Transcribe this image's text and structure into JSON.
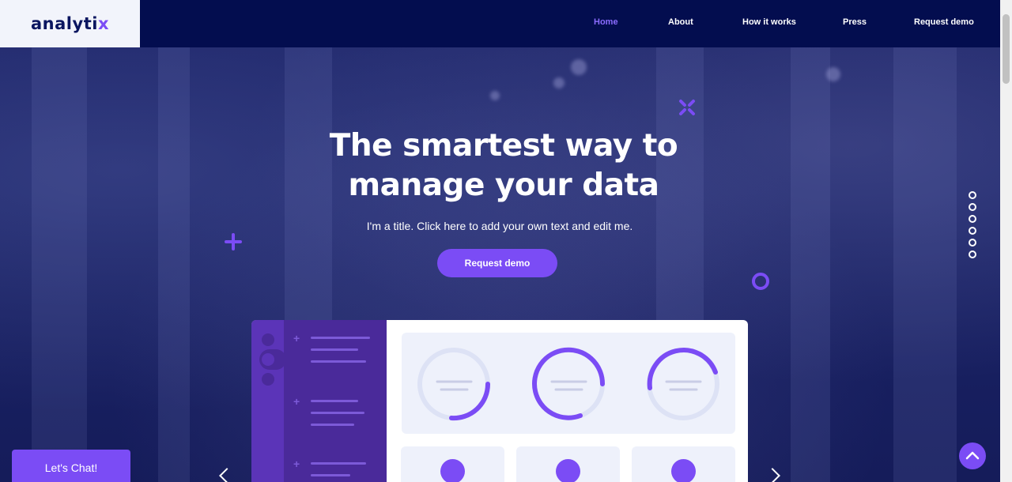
{
  "brand": {
    "logo_main": "analyti",
    "logo_accent": "x"
  },
  "nav": {
    "items": [
      {
        "label": "Home",
        "active": true
      },
      {
        "label": "About",
        "active": false
      },
      {
        "label": "How it works",
        "active": false
      },
      {
        "label": "Press",
        "active": false
      },
      {
        "label": "Request demo",
        "active": false
      }
    ]
  },
  "hero": {
    "title_line1": "The smartest way to",
    "title_line2": "manage your data",
    "subtitle": "I'm a title. Click here to add your own text and edit me.",
    "cta_label": "Request demo"
  },
  "slider": {
    "dot_count": 6
  },
  "chat": {
    "label": "Let's Chat!"
  },
  "icons": {
    "back_to_top": "chevron-up-icon",
    "prev": "chevron-left-icon",
    "next": "chevron-right-icon"
  },
  "colors": {
    "accent": "#7b4cf5",
    "header_bg": "#030d4f",
    "logo_bg": "#f2f4fb",
    "nav_active": "#8b6cff"
  }
}
